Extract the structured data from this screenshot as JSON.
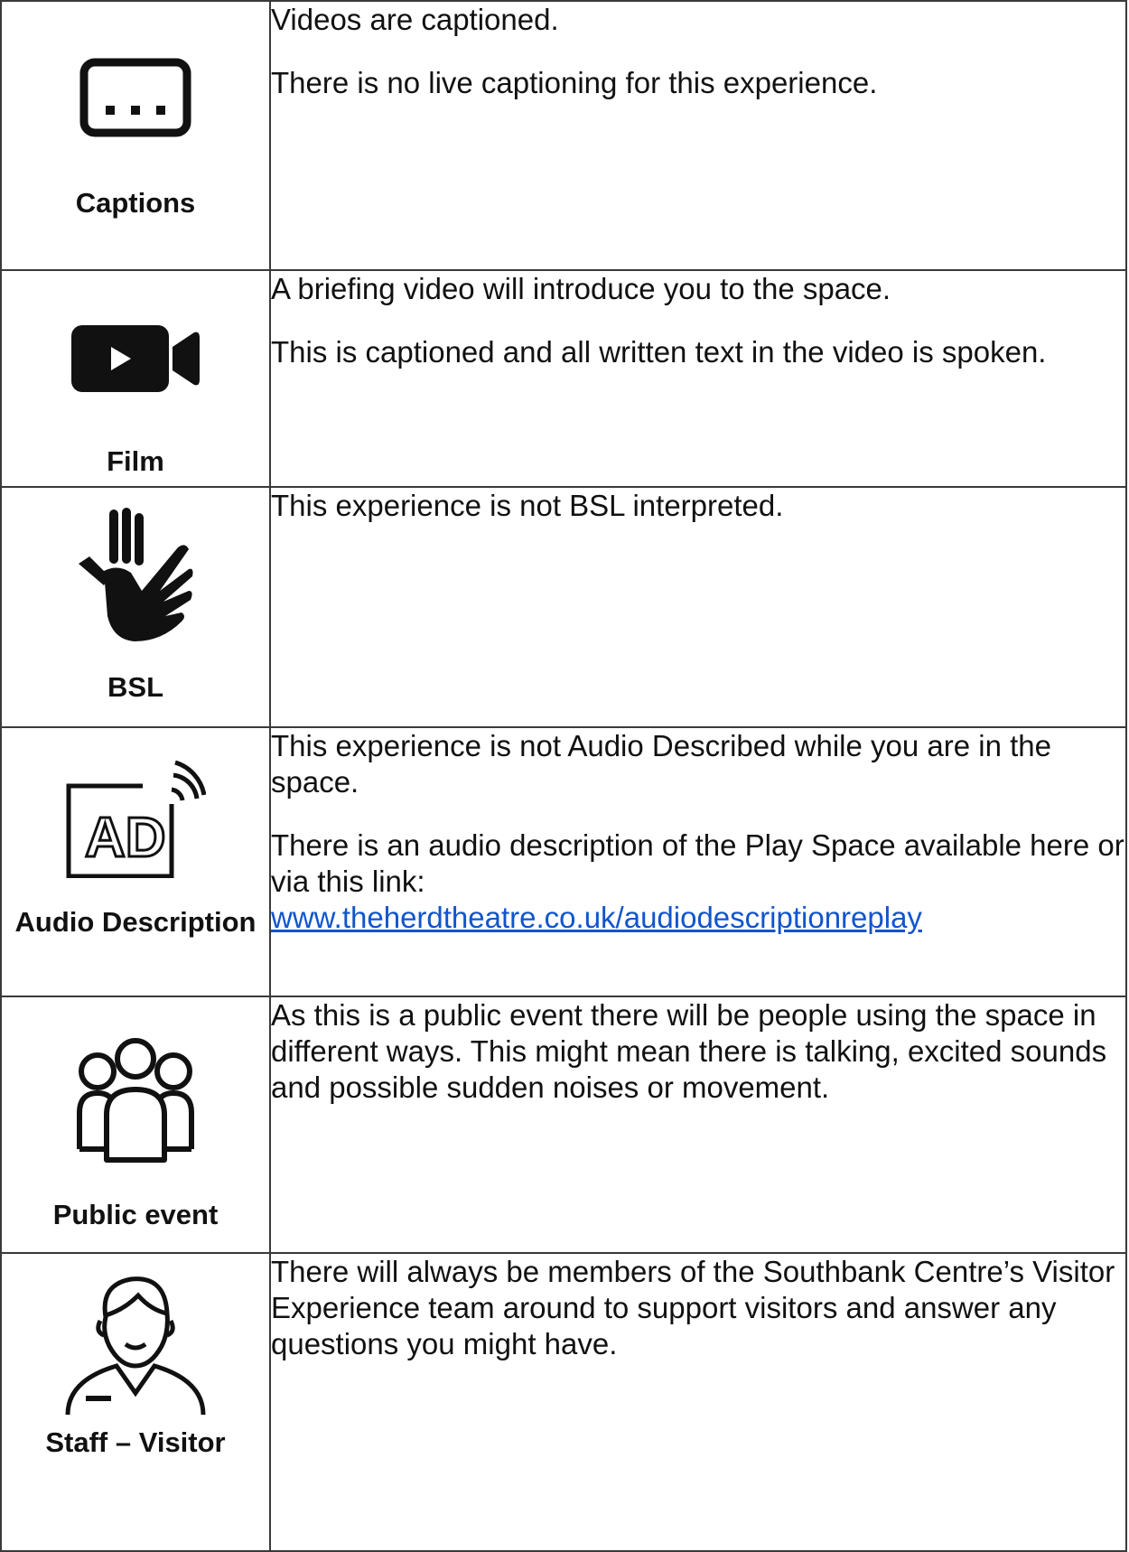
{
  "rows": [
    {
      "label": "Captions",
      "icon": "captions-icon",
      "paragraphs": [
        "Videos are captioned.",
        "There is no live captioning for this experience."
      ]
    },
    {
      "label": "Film",
      "icon": "video-camera-icon",
      "paragraphs": [
        "A briefing video will introduce you to the space.",
        "This is captioned and all written text in the video is spoken."
      ]
    },
    {
      "label": "BSL",
      "icon": "sign-language-hand-icon",
      "paragraphs": [
        "This experience is not BSL interpreted."
      ]
    },
    {
      "label": "Audio Description",
      "icon": "audio-description-icon",
      "paragraphs": [
        "This experience is not Audio Described while you are in the space.",
        "There is an audio description of the Play Space available here or via this link:"
      ],
      "link": "www.theherdtheatre.co.uk/audiodescriptionreplay"
    },
    {
      "label": "Public event",
      "icon": "group-of-people-icon",
      "paragraphs": [
        "As this is a public event there will be people using the space in different ways. This might mean there is talking, excited sounds and possible sudden noises or movement."
      ]
    },
    {
      "label": "Staff – Visitor",
      "icon": "staff-person-icon",
      "paragraphs": [
        "There will always be members of the Southbank Centre’s Visitor Experience team around to support visitors and answer any questions you might have."
      ]
    }
  ]
}
